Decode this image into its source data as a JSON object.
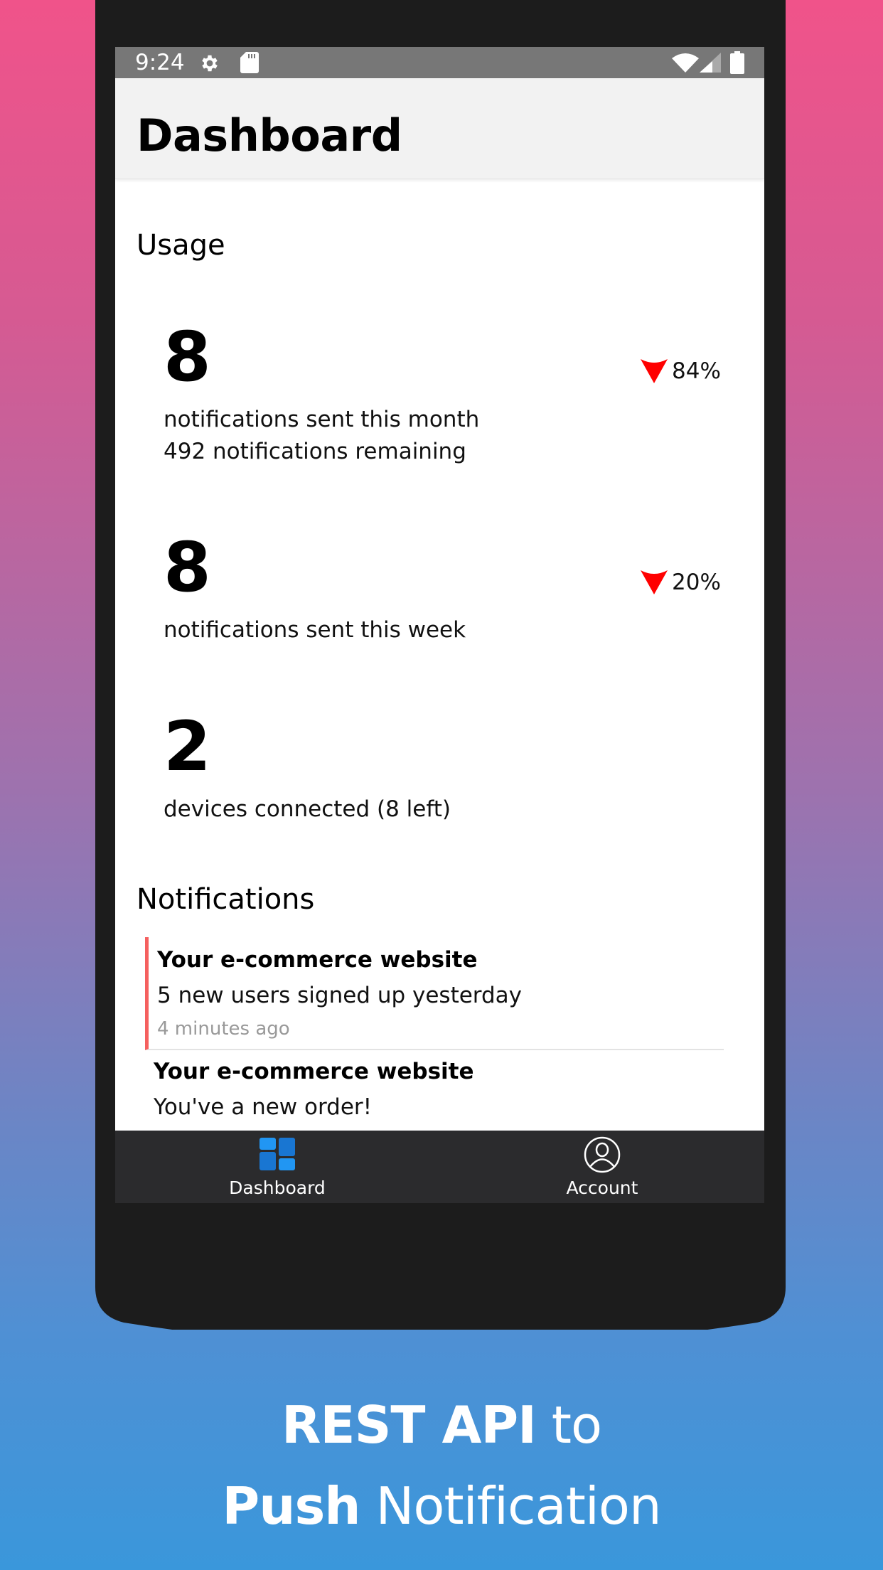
{
  "status_bar": {
    "time": "9:24",
    "left_icons": [
      "gear-icon",
      "sd-card-icon"
    ],
    "right_icons": [
      "wifi-icon",
      "cell-signal-icon",
      "battery-icon"
    ]
  },
  "header": {
    "title": "Dashboard"
  },
  "usage": {
    "title": "Usage",
    "stats": [
      {
        "value": "8",
        "label": "notifications sent this month",
        "sublabel": "492 notifications remaining",
        "trend": {
          "direction": "down",
          "text": "84%",
          "icon": "arrow-down-icon",
          "color": "#FF0000"
        }
      },
      {
        "value": "8",
        "label": "notifications sent this week",
        "trend": {
          "direction": "down",
          "text": "20%",
          "icon": "arrow-down-icon",
          "color": "#FF0000"
        }
      },
      {
        "value": "2",
        "label": "devices connected (8 left)"
      }
    ]
  },
  "notifications": {
    "title": "Notifications",
    "items": [
      {
        "title": "Your e-commerce website",
        "body": "5 new users signed up yesterday",
        "time": "4 minutes ago",
        "unread": true,
        "accent": "#F5605F"
      },
      {
        "title": "Your e-commerce website",
        "body": "You've a new order!"
      }
    ]
  },
  "bottom_nav": {
    "items": [
      {
        "label": "Dashboard",
        "icon": "dashboard-icon",
        "active": true
      },
      {
        "label": "Account",
        "icon": "account-icon",
        "active": false
      }
    ]
  },
  "promo": {
    "line1_bold": "REST API",
    "line1_light": "to",
    "line2_bold": "Push",
    "line2_light": "Notification"
  },
  "colors": {
    "background_top": "#F0538A",
    "background_bottom": "#3A97DB",
    "trend_down": "#FF0000",
    "nav_active_icon": "#1E88E5",
    "nav_bg": "#2B2B2D"
  }
}
